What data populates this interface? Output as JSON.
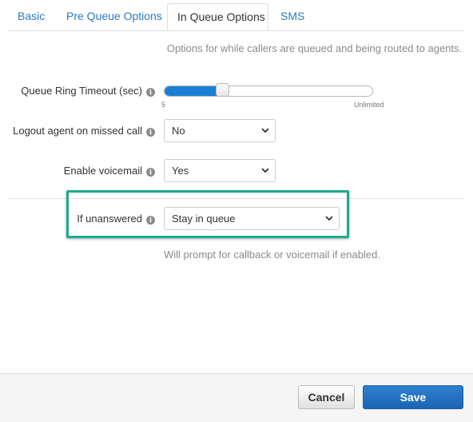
{
  "tabs": [
    {
      "label": "Basic",
      "active": false
    },
    {
      "label": "Pre Queue Options",
      "active": false
    },
    {
      "label": "In Queue Options",
      "active": true
    },
    {
      "label": "SMS",
      "active": false
    }
  ],
  "description": "Options for while callers are queued and being routed to agents.",
  "queue_ring_timeout": {
    "label": "Queue Ring Timeout (sec)",
    "min_label": "5",
    "max_label": "Unlimited",
    "level_fraction": 0.28
  },
  "logout_agent": {
    "label": "Logout agent on missed call",
    "value": "No"
  },
  "enable_voicemail": {
    "label": "Enable voicemail",
    "value": "Yes"
  },
  "if_unanswered": {
    "label": "If unanswered",
    "value": "Stay in queue",
    "help": "Will prompt for callback or voicemail if enabled."
  },
  "info_icon": "info-icon",
  "footer": {
    "cancel_label": "Cancel",
    "save_label": "Save"
  },
  "colors": {
    "accent": "#1a7fd4",
    "highlight": "#1aab8e",
    "save": "#1a65b4"
  }
}
